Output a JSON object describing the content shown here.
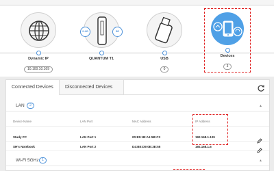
{
  "topology": {
    "internet": {
      "name": "Dynamic IP",
      "value": "10.100.10.169"
    },
    "router": {
      "name": "QUANTUM T1",
      "band_left": "2.4G",
      "band_right": "5G"
    },
    "usb": {
      "name": "USB",
      "value": "0"
    },
    "devices": {
      "name": "Devices",
      "value": "3"
    }
  },
  "tabs": {
    "connected": "Connected Devices",
    "disconnected": "Disconnected Devices"
  },
  "lan": {
    "label": "LAN",
    "count": "2"
  },
  "wifi": {
    "label": "Wi-Fi 5GHz",
    "count": "1"
  },
  "table": {
    "headers": [
      "Device Name",
      "LAN Port",
      "MAC Address",
      "IP Address"
    ],
    "rows": [
      [
        "Study PC",
        "LAN Port 1",
        "00:E5:1B:A1:5B:C3",
        "192.168.1.109"
      ],
      [
        "SH's Notebook",
        "LAN Port 2",
        "D4:BE:D9:0E:3E:55",
        "192.168.1.6"
      ]
    ]
  },
  "colors": {
    "accent": "#4a90d9",
    "highlight": "#e02020"
  }
}
